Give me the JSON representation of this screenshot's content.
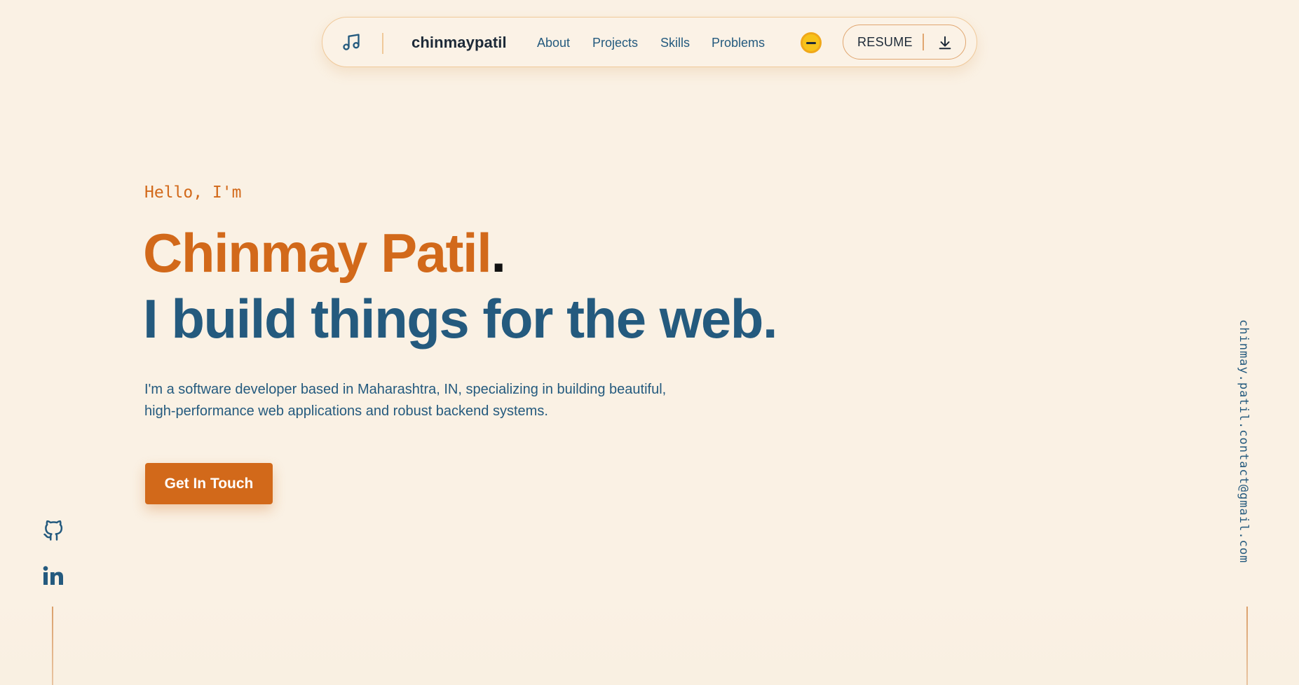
{
  "nav": {
    "brand": "chinmaypatil",
    "links": [
      "About",
      "Projects",
      "Skills",
      "Problems"
    ],
    "resume_label": "RESUME",
    "icons": {
      "music": "music-note-icon",
      "theme": "theme-toggle-icon",
      "download": "download-icon"
    }
  },
  "hero": {
    "greeting": "Hello, I'm",
    "name": "Chinmay Patil",
    "name_suffix": ".",
    "tagline": "I build things for the web.",
    "description": "I'm a software developer based in Maharashtra, IN, specializing in building beautiful, high-performance web applications and robust backend systems.",
    "cta_label": "Get In Touch"
  },
  "social": {
    "icons": [
      "github-icon",
      "linkedin-icon"
    ]
  },
  "contact": {
    "email": "chinmay.patil.contact@gmail.com"
  },
  "colors": {
    "background": "#faf1e4",
    "accent": "#d2691a",
    "primary_text": "#245a7e",
    "brand_text": "#1d2a38",
    "toggle": "#f7c21a"
  }
}
